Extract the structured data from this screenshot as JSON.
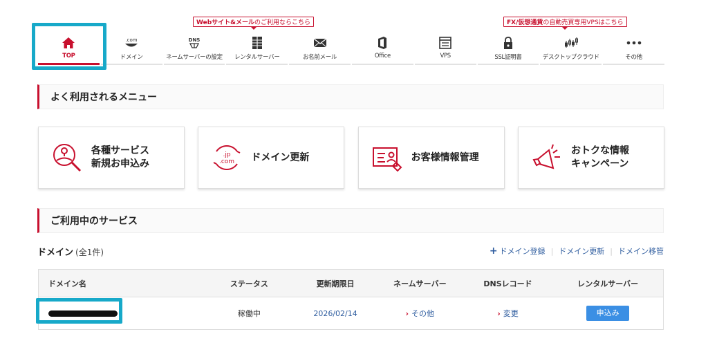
{
  "nav": {
    "items": [
      {
        "label": "TOP",
        "icon": "home-icon"
      },
      {
        "label": "ドメイン",
        "icon": "dot-com-icon",
        "icon_text": ".com"
      },
      {
        "label": "ネームサーバーの設定",
        "icon": "dns-icon",
        "icon_text": "DNS"
      },
      {
        "label": "レンタルサーバー",
        "icon": "server-icon"
      },
      {
        "label": "お名前メール",
        "icon": "mail-icon"
      },
      {
        "label": "Office",
        "icon": "office-icon"
      },
      {
        "label": "VPS",
        "icon": "vps-icon"
      },
      {
        "label": "SSL証明書",
        "icon": "lock-icon"
      },
      {
        "label": "デスクトップクラウド",
        "icon": "chart-icon"
      },
      {
        "label": "その他",
        "icon": "more-icon"
      }
    ],
    "promo1": {
      "bold": "Webサイト&メール",
      "rest": "のご利用ならこちら"
    },
    "promo2": {
      "bold": "FX/仮想通貨",
      "rest": "の自動売買専用VPSはこちら"
    }
  },
  "frequent": {
    "title": "よく利用されるメニュー",
    "cards": [
      {
        "label": "各種サービス\n新規お申込み",
        "icon": "apply-search-icon"
      },
      {
        "label": "ドメイン更新",
        "icon": "domain-renew-icon",
        "icon_line1": ".jp",
        "icon_line2": ".com"
      },
      {
        "label": "お客様情報管理",
        "icon": "customer-info-icon"
      },
      {
        "label": "おトクな情報\nキャンペーン",
        "icon": "megaphone-icon"
      }
    ]
  },
  "services": {
    "title": "ご利用中のサービス",
    "domain_title": "ドメイン",
    "domain_count": "(全1件)",
    "links": {
      "register": "ドメイン登録",
      "renew": "ドメイン更新",
      "transfer": "ドメイン移管"
    },
    "table": {
      "headers": [
        "ドメイン名",
        "ステータス",
        "更新期限日",
        "ネームサーバー",
        "DNSレコード",
        "レンタルサーバー"
      ],
      "rows": [
        {
          "status": "稼働中",
          "expiry": "2026/02/14",
          "nameserver": "その他",
          "dns": "変更",
          "server_button": "申込み"
        }
      ]
    }
  },
  "colors": {
    "accent": "#c8102e",
    "link": "#2f5d9f",
    "highlight": "#17a9c9",
    "button": "#3b8fe4"
  }
}
